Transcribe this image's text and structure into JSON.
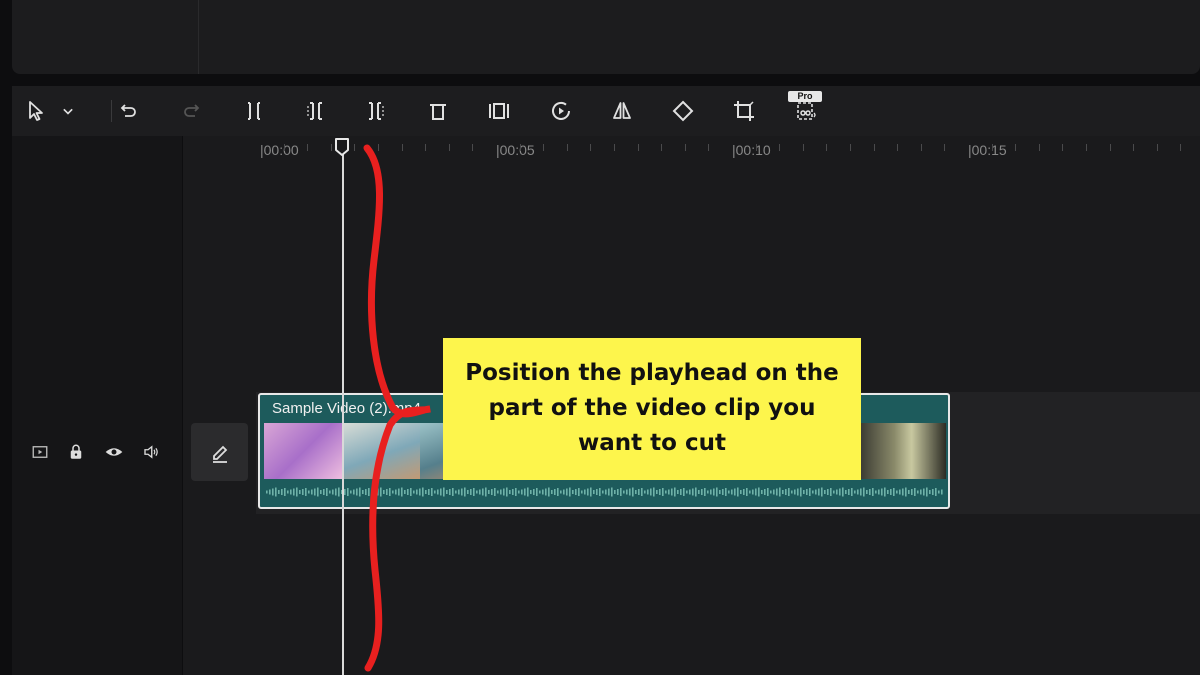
{
  "toolbar": {
    "tools": [
      {
        "name": "select-tool",
        "icon": "cursor-arrow-icon"
      },
      {
        "name": "select-dropdown",
        "icon": "chevron-down-icon"
      },
      {
        "name": "undo",
        "icon": "undo-icon"
      },
      {
        "name": "redo",
        "icon": "redo-icon"
      },
      {
        "name": "split",
        "icon": "split-icon"
      },
      {
        "name": "split-left",
        "icon": "trim-left-icon"
      },
      {
        "name": "split-right",
        "icon": "trim-right-icon"
      },
      {
        "name": "delete",
        "icon": "trash-icon"
      },
      {
        "name": "freeze",
        "icon": "freeze-frame-icon"
      },
      {
        "name": "reverse",
        "icon": "reverse-icon"
      },
      {
        "name": "mirror",
        "icon": "mirror-icon"
      },
      {
        "name": "rotate",
        "icon": "rotate-icon"
      },
      {
        "name": "crop",
        "icon": "crop-icon"
      },
      {
        "name": "cutout",
        "icon": "scissors-audio-icon"
      }
    ],
    "pro_badge": "Pro"
  },
  "ruler": {
    "labels": [
      "|00:00",
      "|00:05",
      "|00:10",
      "|00:15"
    ]
  },
  "track": {
    "icons": [
      "video-track-icon",
      "lock-icon",
      "eye-icon",
      "volume-icon"
    ],
    "edit_icon": "pencil-icon"
  },
  "clip": {
    "name": "Sample Video (2).mp4",
    "color": "#1d5b5c"
  },
  "callout": {
    "text": "Position the playhead on the part of the video clip you want to cut"
  },
  "colors": {
    "annotation_red": "#e8201f",
    "callout_yellow": "#fdf54c"
  }
}
